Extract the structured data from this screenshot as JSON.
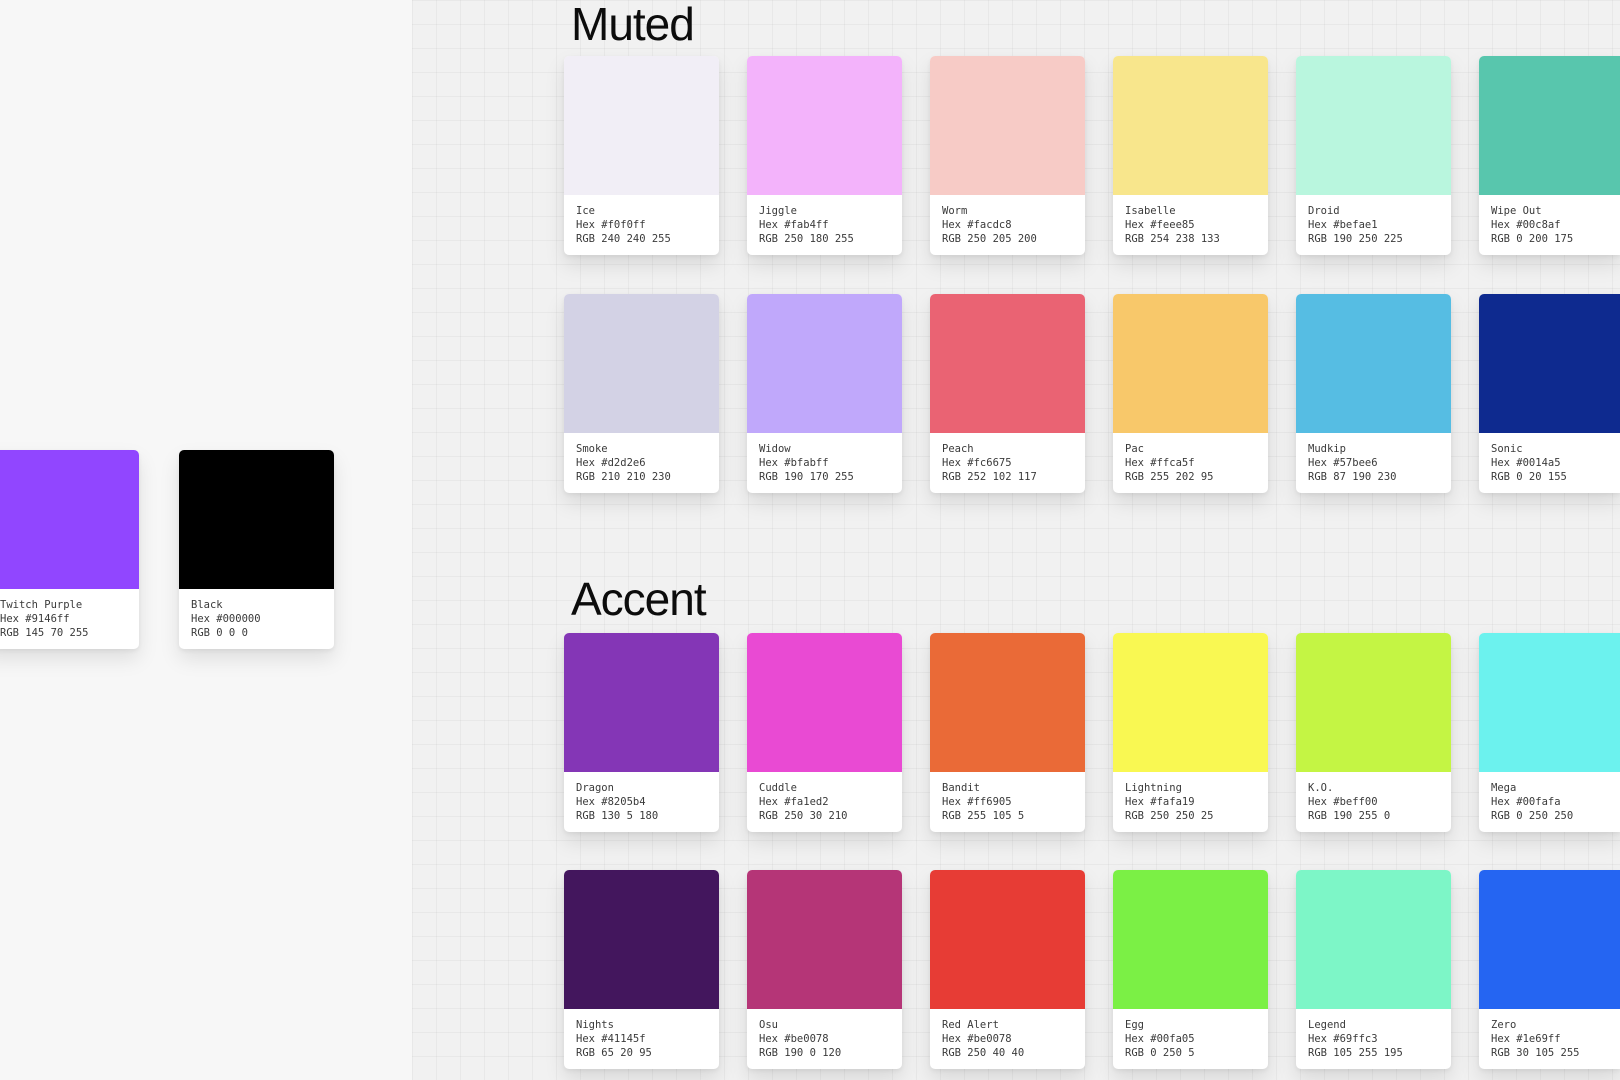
{
  "brand": [
    {
      "name": "Twitch Purple",
      "hex": "Hex #9146ff",
      "rgb": "RGB 145 70 255",
      "color": "#9146ff"
    },
    {
      "name": "Black",
      "hex": "Hex #000000",
      "rgb": "RGB 0 0 0",
      "color": "#000000"
    }
  ],
  "muted": {
    "title": "Muted",
    "swatches": [
      {
        "name": "Ice",
        "hex": "Hex #f0f0ff",
        "rgb": "RGB 240 240 255",
        "color": "#f1eef6"
      },
      {
        "name": "Jiggle",
        "hex": "Hex #fab4ff",
        "rgb": "RGB 250 180 255",
        "color": "#f3b3fb"
      },
      {
        "name": "Worm",
        "hex": "Hex #facdc8",
        "rgb": "RGB 250 205 200",
        "color": "#f7cbc6"
      },
      {
        "name": "Isabelle",
        "hex": "Hex #feee85",
        "rgb": "RGB 254 238 133",
        "color": "#f8e68c"
      },
      {
        "name": "Droid",
        "hex": "Hex #befae1",
        "rgb": "RGB 190 250 225",
        "color": "#b9f6de"
      },
      {
        "name": "Wipe Out",
        "hex": "Hex #00c8af",
        "rgb": "RGB 0 200 175",
        "color": "#58c6ad"
      },
      {
        "name": "Smoke",
        "hex": "Hex #d2d2e6",
        "rgb": "RGB 210 210 230",
        "color": "#d3d2e5"
      },
      {
        "name": "Widow",
        "hex": "Hex #bfabff",
        "rgb": "RGB 190 170 255",
        "color": "#c0a8fb"
      },
      {
        "name": "Peach",
        "hex": "Hex #fc6675",
        "rgb": "RGB 252 102 117",
        "color": "#ea6373"
      },
      {
        "name": "Pac",
        "hex": "Hex #ffca5f",
        "rgb": "RGB 255 202 95",
        "color": "#f8c86a"
      },
      {
        "name": "Mudkip",
        "hex": "Hex #57bee6",
        "rgb": "RGB 87 190 230",
        "color": "#56bde3"
      },
      {
        "name": "Sonic",
        "hex": "Hex #0014a5",
        "rgb": "RGB 0 20 155",
        "color": "#0e2a8f"
      }
    ]
  },
  "accent": {
    "title": "Accent",
    "swatches": [
      {
        "name": "Dragon",
        "hex": "Hex #8205b4",
        "rgb": "RGB 130 5 180",
        "color": "#8436b6"
      },
      {
        "name": "Cuddle",
        "hex": "Hex #fa1ed2",
        "rgb": "RGB 250 30 210",
        "color": "#e94ad3"
      },
      {
        "name": "Bandit",
        "hex": "Hex #ff6905",
        "rgb": "RGB 255 105 5",
        "color": "#ea6a37"
      },
      {
        "name": "Lightning",
        "hex": "Hex #fafa19",
        "rgb": "RGB 250 250 25",
        "color": "#f9f852"
      },
      {
        "name": "K.O.",
        "hex": "Hex #beff00",
        "rgb": "RGB 190 255 0",
        "color": "#c4f544"
      },
      {
        "name": "Mega",
        "hex": "Hex #00fafa",
        "rgb": "RGB 0 250 250",
        "color": "#6cf2ee"
      },
      {
        "name": "Nights",
        "hex": "Hex #41145f",
        "rgb": "RGB 65 20 95",
        "color": "#43165d"
      },
      {
        "name": "Osu",
        "hex": "Hex #be0078",
        "rgb": "RGB 190 0 120",
        "color": "#b53577"
      },
      {
        "name": "Red Alert",
        "hex": "Hex #be0078",
        "rgb": "RGB 250 40 40",
        "color": "#e73c35"
      },
      {
        "name": "Egg",
        "hex": "Hex #00fa05",
        "rgb": "RGB 0 250 5",
        "color": "#7bf045"
      },
      {
        "name": "Legend",
        "hex": "Hex #69ffc3",
        "rgb": "RGB 105 255 195",
        "color": "#7df6c7"
      },
      {
        "name": "Zero",
        "hex": "Hex #1e69ff",
        "rgb": "RGB 30 105 255",
        "color": "#2565f2"
      }
    ]
  }
}
